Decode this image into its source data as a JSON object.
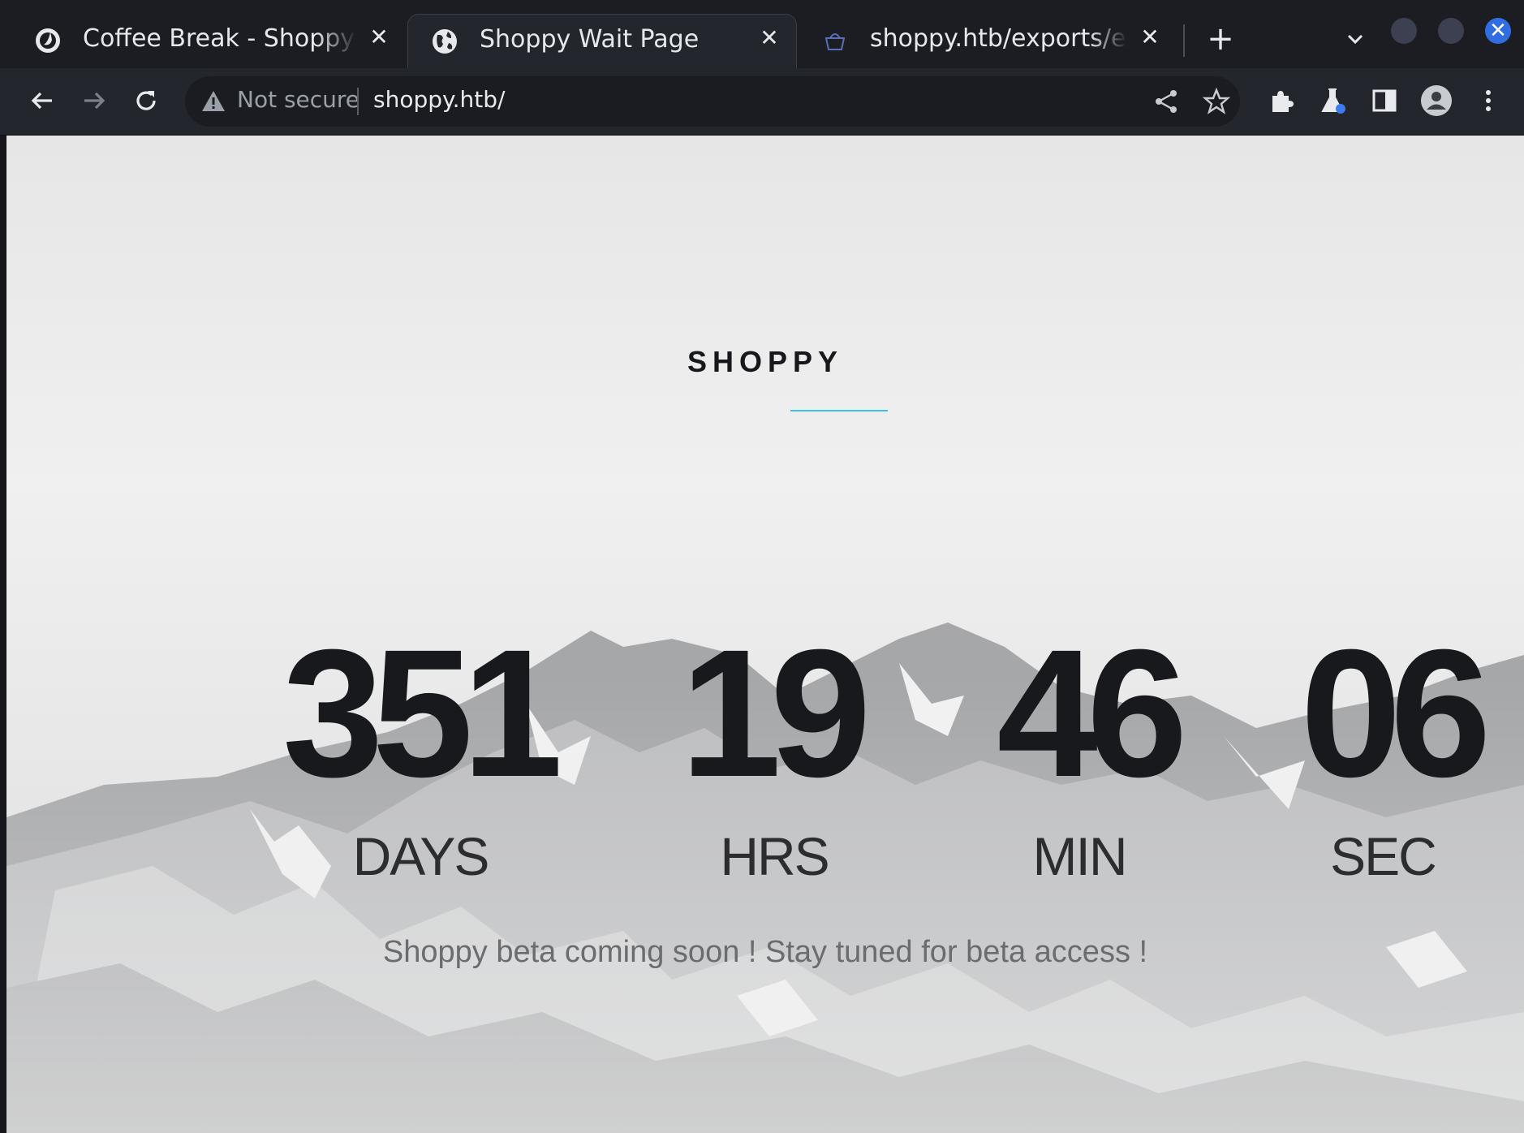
{
  "browser": {
    "tabs": [
      {
        "title": "Coffee Break - Shoppy Ma",
        "active": false,
        "icon": "mattermost-icon"
      },
      {
        "title": "Shoppy Wait Page",
        "active": true,
        "icon": "globe-icon"
      },
      {
        "title": "shoppy.htb/exports/expor",
        "active": false,
        "icon": "shoppy-favicon-icon"
      }
    ],
    "tab_close_glyph": "✕",
    "new_tab_glyph": "+",
    "address": {
      "security": "Not secure",
      "url": "shoppy.htb/"
    }
  },
  "page": {
    "brand": "SHOPPY",
    "countdown": [
      {
        "value": "351",
        "label": "DAYS"
      },
      {
        "value": "19",
        "label": "HRS"
      },
      {
        "value": "46",
        "label": "MIN"
      },
      {
        "value": "06",
        "label": "SEC"
      }
    ],
    "tagline": "Shoppy beta coming soon ! Stay tuned for beta access !",
    "accent_color": "#35c5de"
  }
}
